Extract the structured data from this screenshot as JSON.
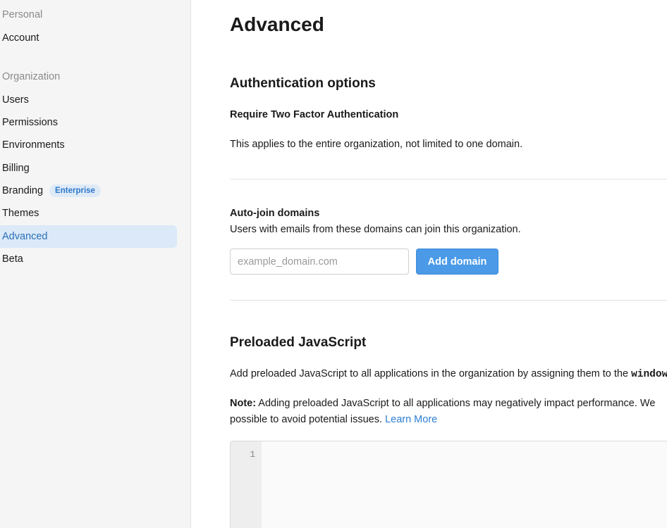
{
  "sidebar": {
    "personal_label": "Personal",
    "account": "Account",
    "organization_label": "Organization",
    "items": [
      {
        "label": "Users"
      },
      {
        "label": "Permissions"
      },
      {
        "label": "Environments"
      },
      {
        "label": "Billing"
      },
      {
        "label": "Branding",
        "badge": "Enterprise"
      },
      {
        "label": "Themes"
      },
      {
        "label": "Advanced",
        "active": true
      },
      {
        "label": "Beta"
      }
    ]
  },
  "main": {
    "title": "Advanced",
    "auth": {
      "heading": "Authentication options",
      "subheading": "Require Two Factor Authentication",
      "description": "This applies to the entire organization, not limited to one domain."
    },
    "autojoin": {
      "heading": "Auto-join domains",
      "description": "Users with emails from these domains can join this organization.",
      "input_placeholder": "example_domain.com",
      "input_value": "",
      "button_label": "Add domain"
    },
    "preload": {
      "heading": "Preloaded JavaScript",
      "line1_text": "Add preloaded JavaScript to all applications in the organization by assigning them to the ",
      "line1_code": "window",
      "note_label": "Note:",
      "note_text": " Adding preloaded JavaScript to all applications may negatively impact performance. We",
      "note_line2": "possible to avoid potential issues. ",
      "learn_more": "Learn More",
      "editor_line_numbers": [
        "1"
      ]
    }
  },
  "colors": {
    "accent": "#4a9ae8",
    "active_bg": "#dbe9f8",
    "active_text": "#2a6fb8",
    "link": "#2c7fd0",
    "sidebar_bg": "#f5f5f5"
  }
}
